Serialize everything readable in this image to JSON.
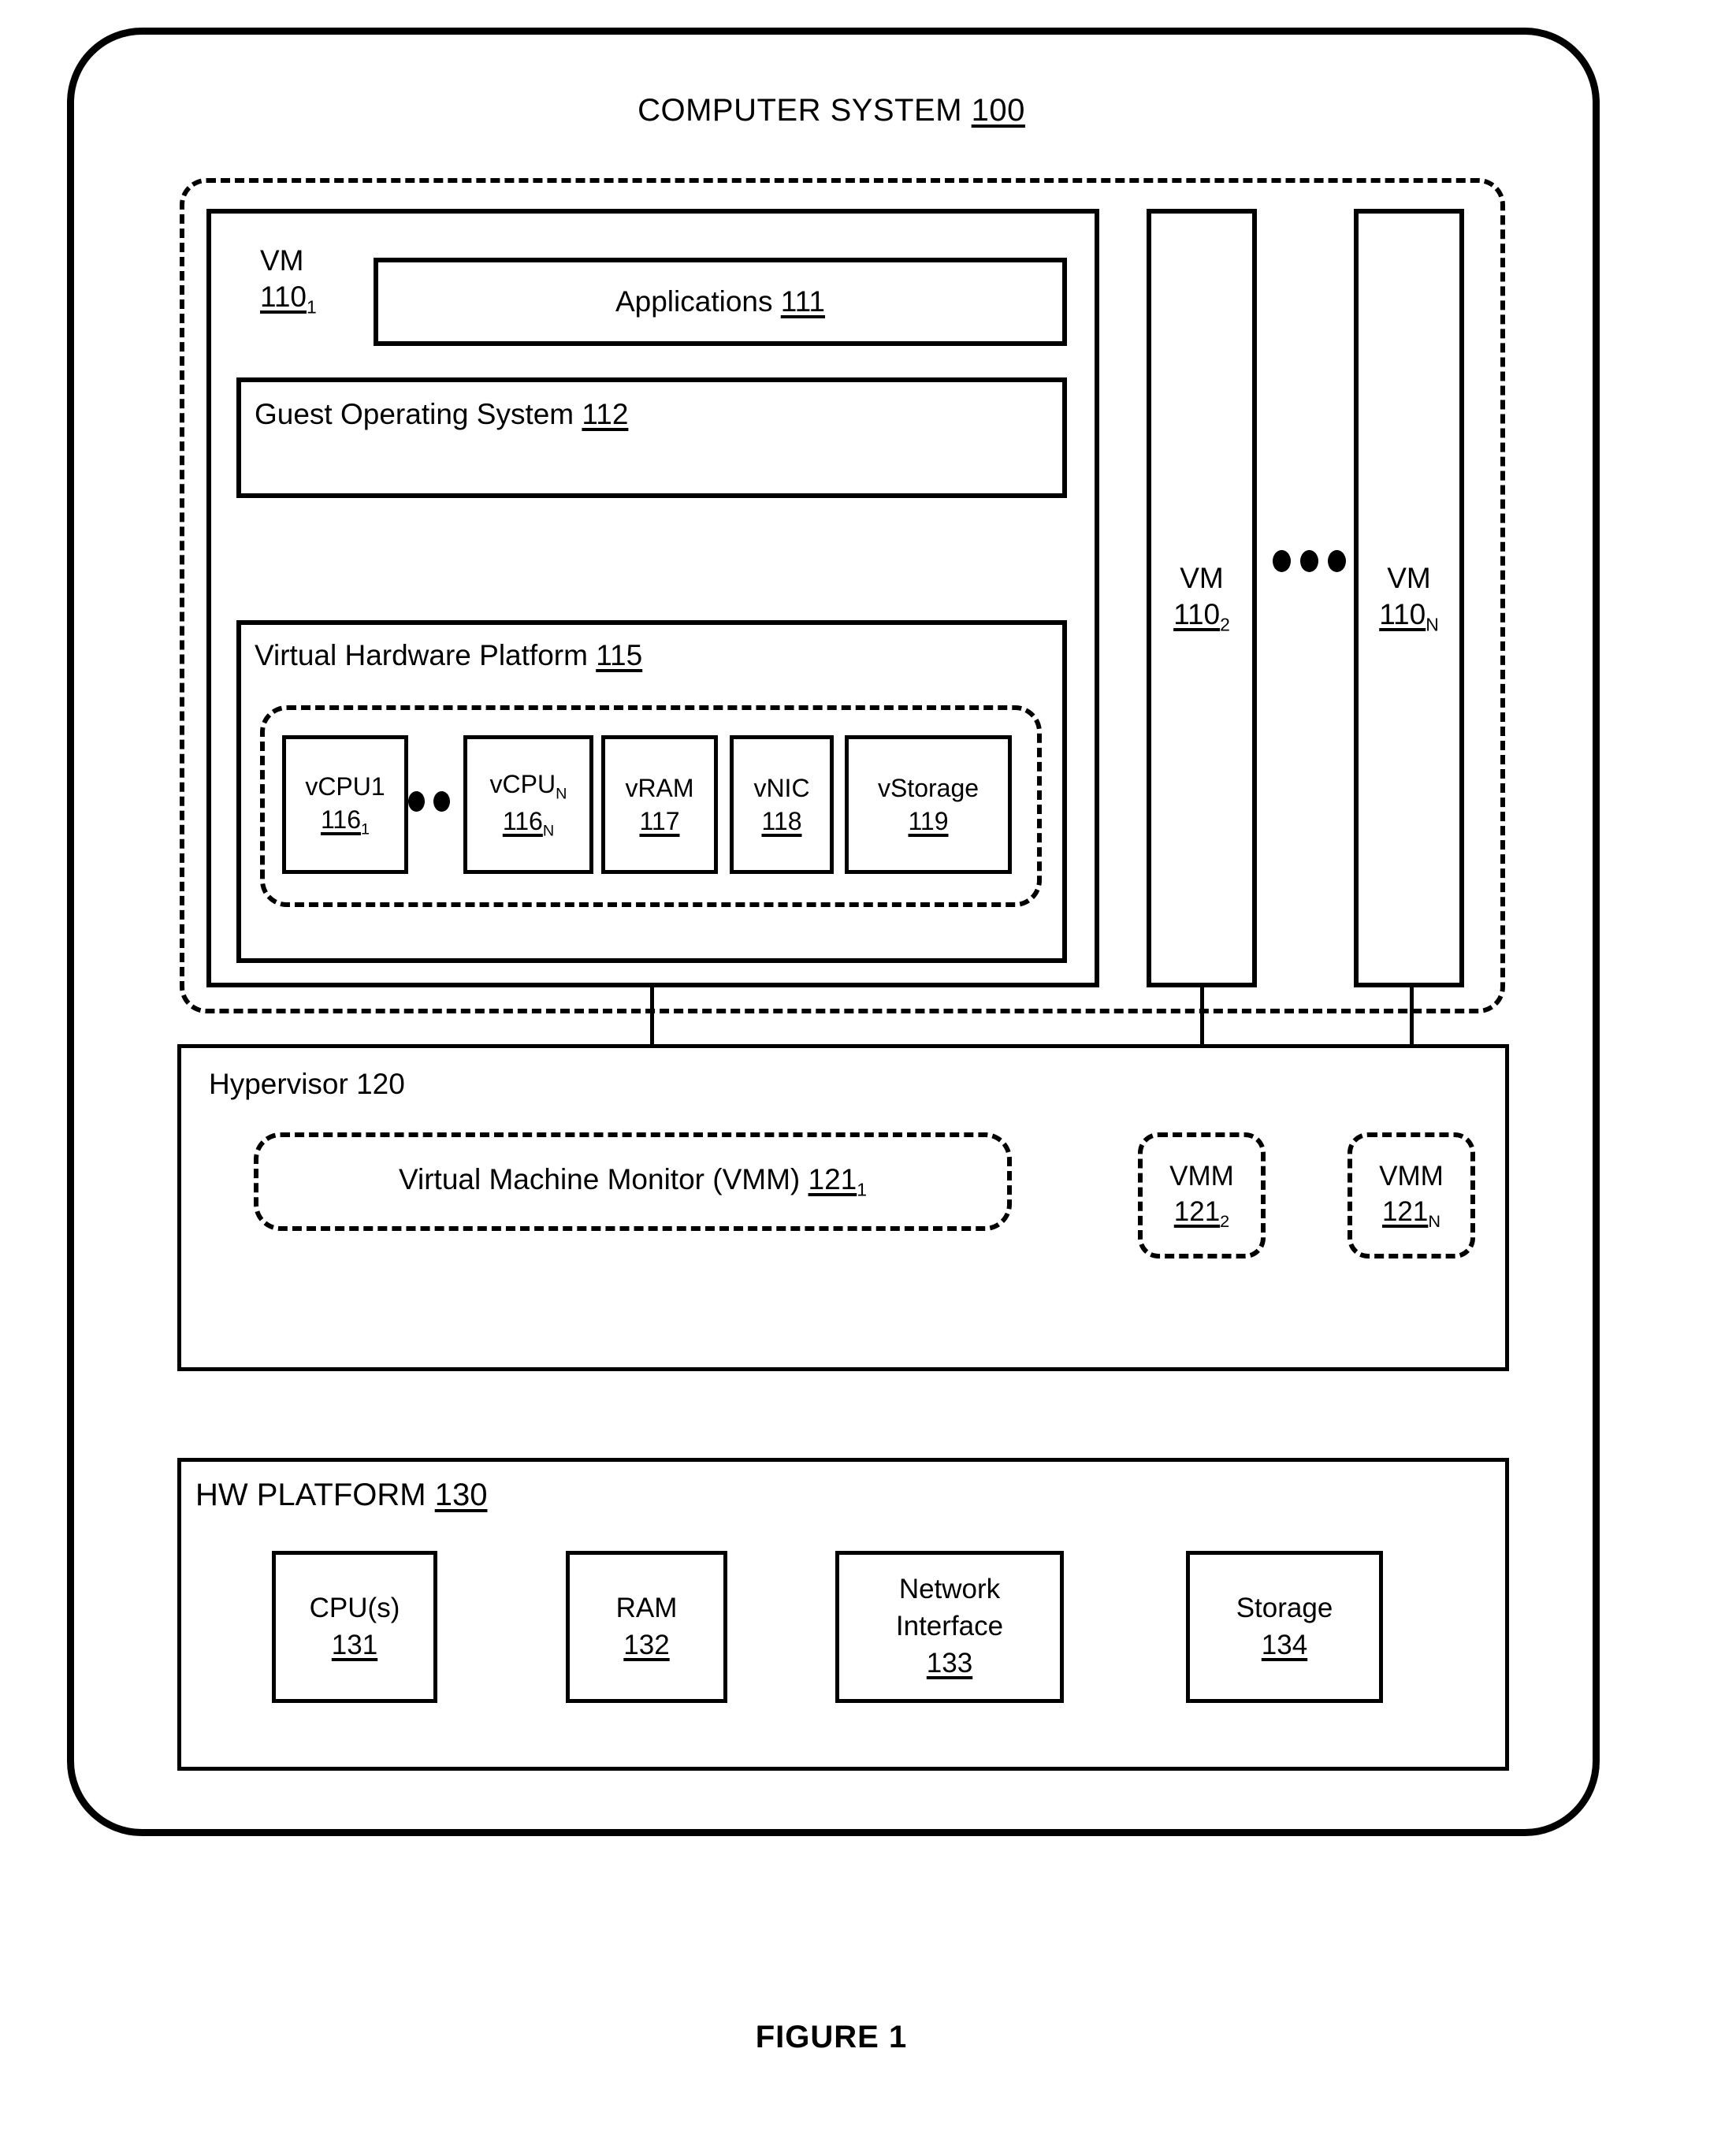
{
  "figure": {
    "caption": "FIGURE 1"
  },
  "system": {
    "title_text": "COMPUTER SYSTEM",
    "title_ref": "100"
  },
  "vm1": {
    "label_text": "VM",
    "label_ref": "110",
    "label_sub": "1",
    "applications": {
      "text": "Applications",
      "ref": "111"
    },
    "guest_os": {
      "text": "Guest Operating System",
      "ref": "112"
    },
    "virtual_hw_platform": {
      "text": "Virtual Hardware Platform",
      "ref": "115"
    },
    "devices": [
      {
        "name": "vCPU1",
        "ref": "116",
        "sub": "1"
      },
      {
        "name": "vCPU",
        "name_sub": "N",
        "ref": "116",
        "sub": "N"
      },
      {
        "name": "vRAM",
        "ref": "117",
        "sub": ""
      },
      {
        "name": "vNIC",
        "ref": "118",
        "sub": ""
      },
      {
        "name": "vStorage",
        "ref": "119",
        "sub": ""
      }
    ]
  },
  "vm_columns": [
    {
      "label_text": "VM",
      "ref": "110",
      "sub": "2"
    },
    {
      "label_text": "VM",
      "ref": "110",
      "sub": "N"
    }
  ],
  "hypervisor": {
    "label_text": "Hypervisor",
    "label_ref": "120",
    "vmm1": {
      "text": "Virtual Machine Monitor (VMM)",
      "ref": "121",
      "sub": "1"
    },
    "vmm_small": [
      {
        "text": "VMM",
        "ref": "121",
        "sub": "2"
      },
      {
        "text": "VMM",
        "ref": "121",
        "sub": "N"
      }
    ]
  },
  "hw_platform": {
    "label_text": "HW PLATFORM",
    "label_ref": "130",
    "items": [
      {
        "line1": "CPU(s)",
        "line2": "",
        "ref": "131"
      },
      {
        "line1": "RAM",
        "line2": "",
        "ref": "132"
      },
      {
        "line1": "Network",
        "line2": "Interface",
        "ref": "133"
      },
      {
        "line1": "Storage",
        "line2": "",
        "ref": "134"
      }
    ]
  },
  "ellipsis": {
    "vm_columns_dots": "3",
    "vdev_dots": "2"
  },
  "colors": {
    "stroke": "#000000",
    "background": "#ffffff"
  }
}
